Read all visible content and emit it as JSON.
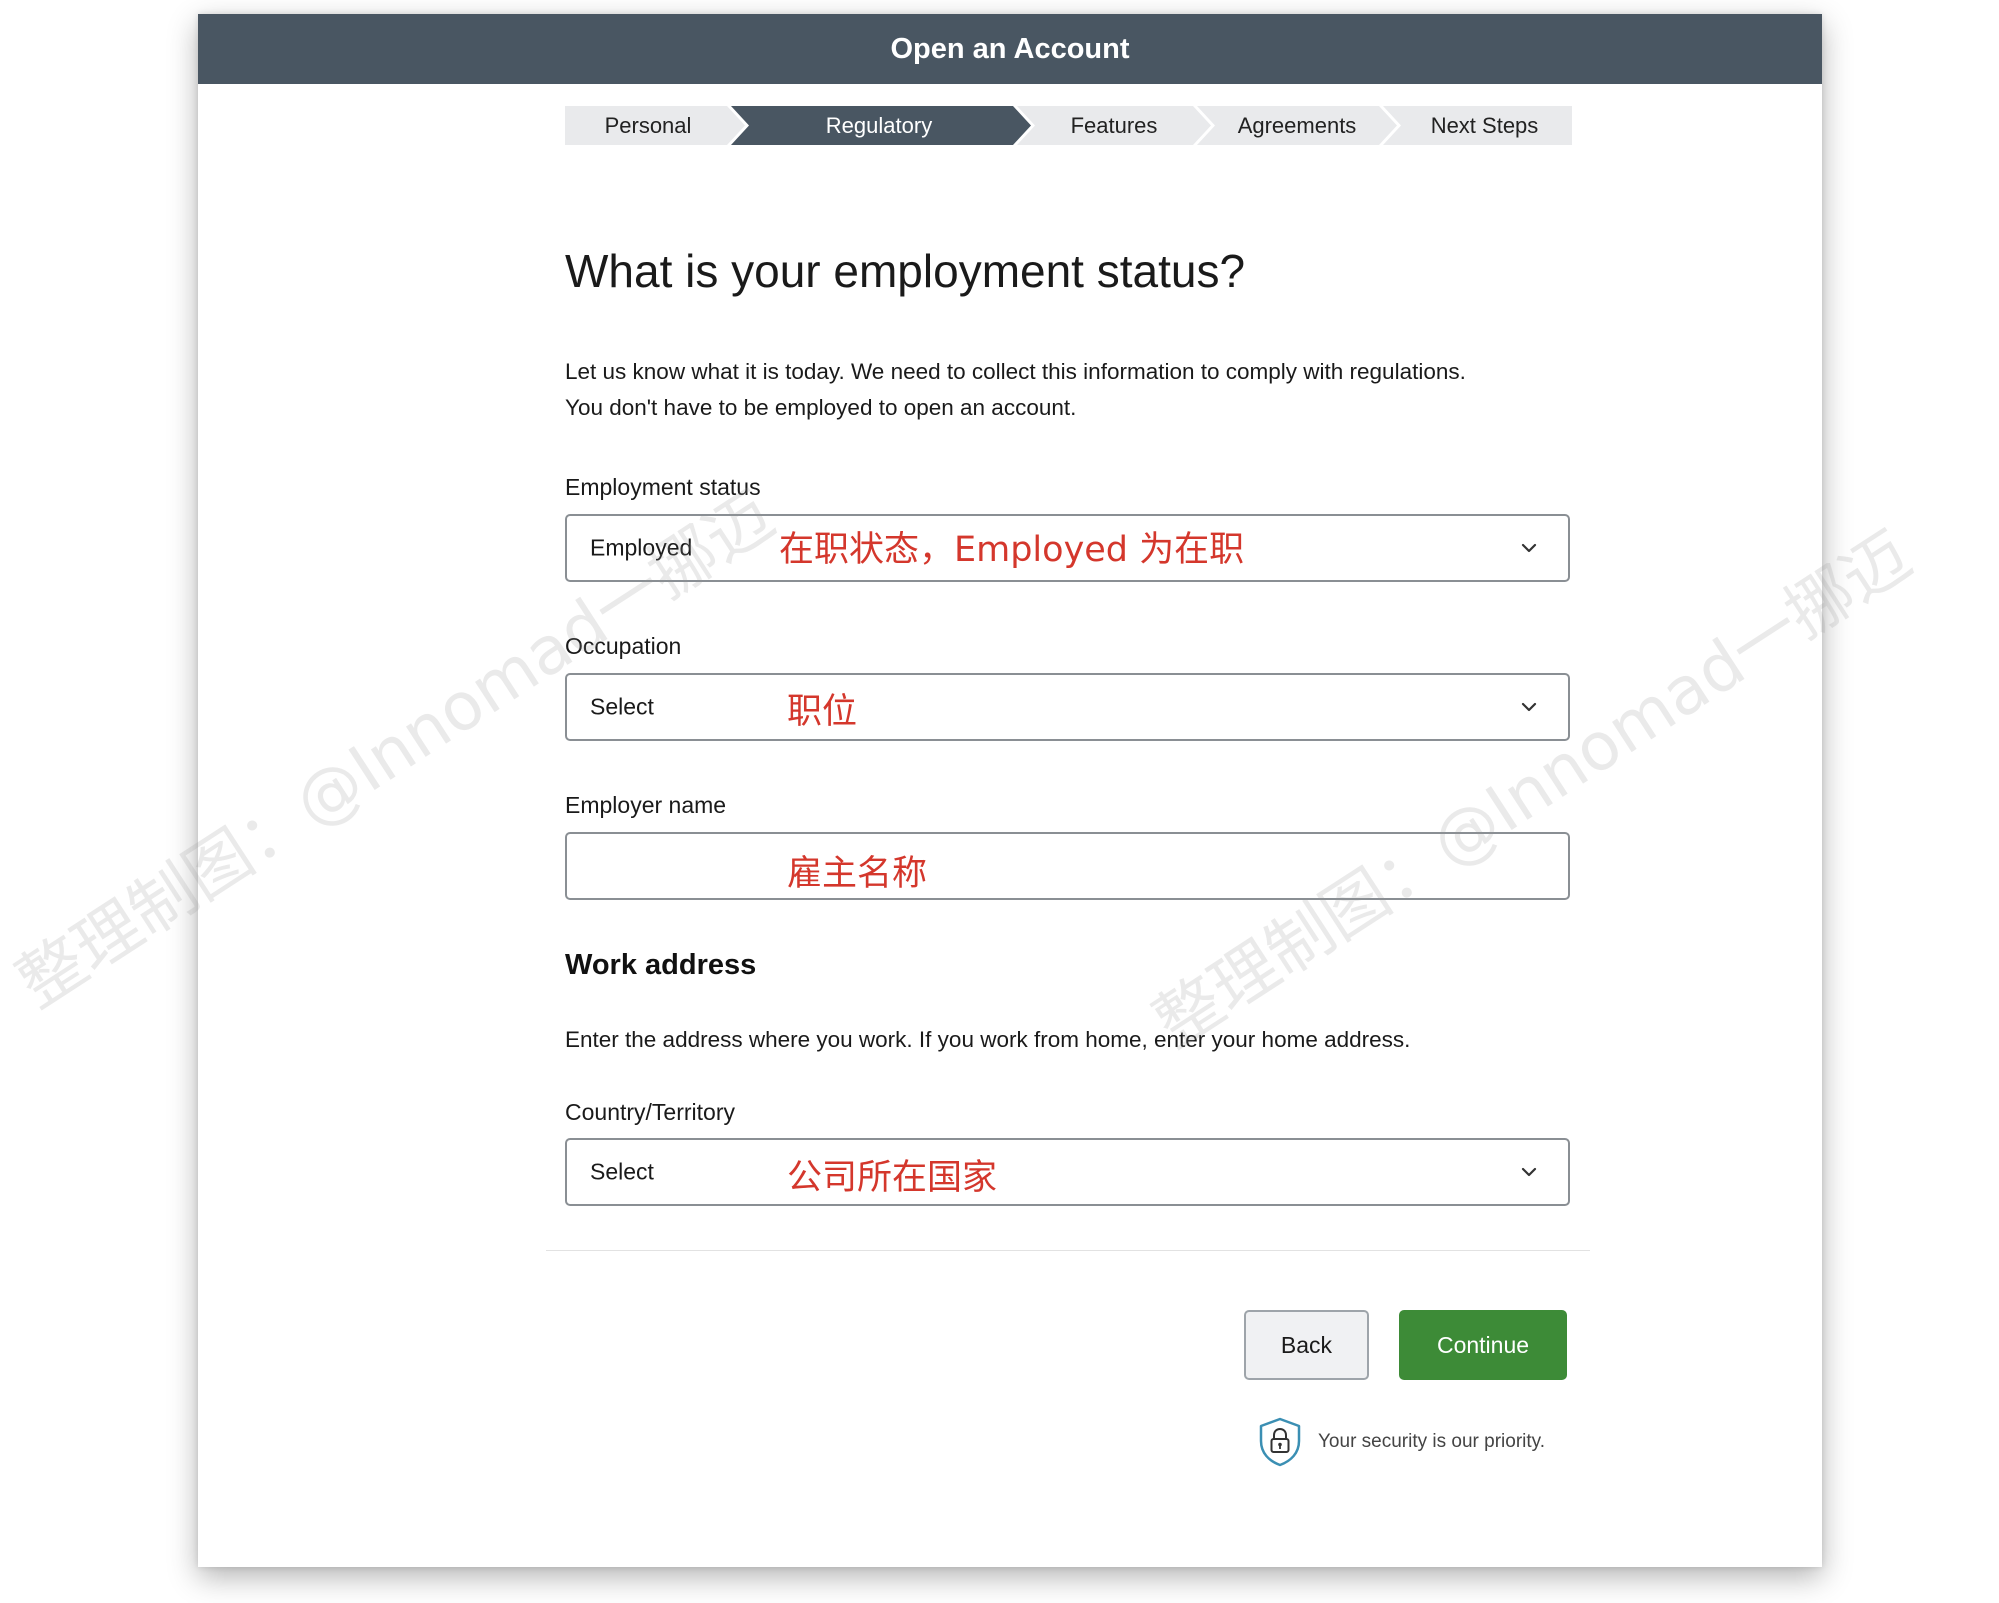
{
  "window": {
    "title": "Open an Account"
  },
  "stepper": {
    "steps": [
      {
        "label": "Personal"
      },
      {
        "label": "Regulatory"
      },
      {
        "label": "Features"
      },
      {
        "label": "Agreements"
      },
      {
        "label": "Next Steps"
      }
    ],
    "active_index": 1
  },
  "page": {
    "heading": "What is your employment status?",
    "intro_line1": "Let us know what it is today. We need to collect this information to comply with regulations.",
    "intro_line2": "You don't have to be employed to open an account."
  },
  "form": {
    "employment_status": {
      "label": "Employment status",
      "value": "Employed",
      "annotation": "在职状态，Employed 为在职",
      "icon": "chevron-down-icon"
    },
    "occupation": {
      "label": "Occupation",
      "value": "Select",
      "annotation": "职位",
      "icon": "chevron-down-icon"
    },
    "employer_name": {
      "label": "Employer name",
      "value": "",
      "annotation": "雇主名称"
    },
    "work_address": {
      "title": "Work address",
      "description": "Enter the address where you work. If you work from home, enter your home address."
    },
    "country": {
      "label": "Country/Territory",
      "value": "Select",
      "annotation": "公司所在国家",
      "icon": "chevron-down-icon"
    }
  },
  "actions": {
    "back_label": "Back",
    "continue_label": "Continue"
  },
  "security": {
    "text": "Your security is our priority.",
    "icon": "shield-lock-icon"
  },
  "watermark": {
    "text": "整理制图：@Innomad一挪迈"
  },
  "colors": {
    "titlebar": "#495662",
    "stepper_active": "#495662",
    "stepper_inactive": "#e9eaec",
    "continue_button": "#3d8b37",
    "annotation": "#d4372c"
  }
}
